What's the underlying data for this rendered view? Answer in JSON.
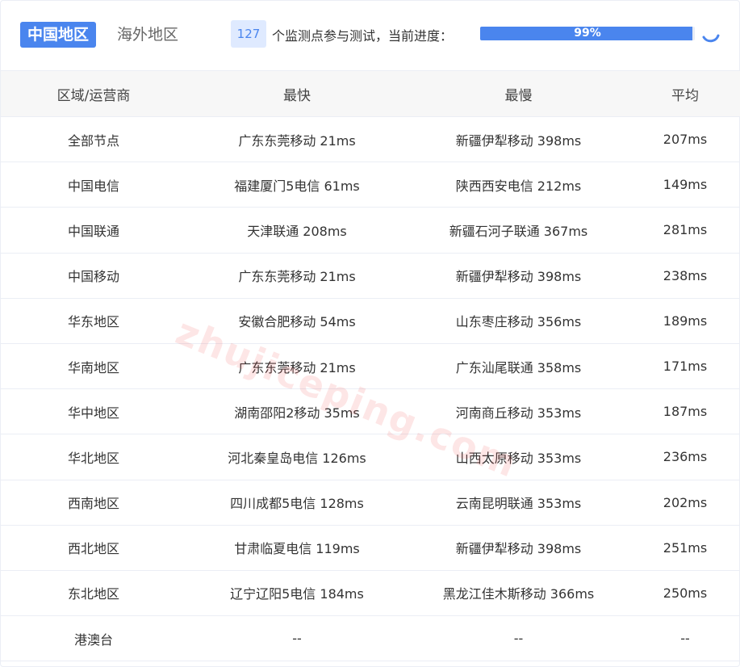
{
  "tabs": {
    "china": "中国地区",
    "overseas": "海外地区"
  },
  "monitor": {
    "count": "127",
    "text": "个监测点参与测试，当前进度：",
    "progress_label": "99%",
    "progress_fraction": 0.99
  },
  "watermark": "zhujiceping.com",
  "table": {
    "headers": [
      "区域/运营商",
      "最快",
      "最慢",
      "平均"
    ],
    "rows": [
      [
        "全部节点",
        "广东东莞移动 21ms",
        "新疆伊犁移动 398ms",
        "207ms"
      ],
      [
        "中国电信",
        "福建厦门5电信 61ms",
        "陕西西安电信 212ms",
        "149ms"
      ],
      [
        "中国联通",
        "天津联通 208ms",
        "新疆石河子联通 367ms",
        "281ms"
      ],
      [
        "中国移动",
        "广东东莞移动 21ms",
        "新疆伊犁移动 398ms",
        "238ms"
      ],
      [
        "华东地区",
        "安徽合肥移动 54ms",
        "山东枣庄移动 356ms",
        "189ms"
      ],
      [
        "华南地区",
        "广东东莞移动 21ms",
        "广东汕尾联通 358ms",
        "171ms"
      ],
      [
        "华中地区",
        "湖南邵阳2移动 35ms",
        "河南商丘移动 353ms",
        "187ms"
      ],
      [
        "华北地区",
        "河北秦皇岛电信 126ms",
        "山西太原移动 353ms",
        "236ms"
      ],
      [
        "西南地区",
        "四川成都5电信 128ms",
        "云南昆明联通 353ms",
        "202ms"
      ],
      [
        "西北地区",
        "甘肃临夏电信 119ms",
        "新疆伊犁移动 398ms",
        "251ms"
      ],
      [
        "东北地区",
        "辽宁辽阳5电信 184ms",
        "黑龙江佳木斯移动 366ms",
        "250ms"
      ],
      [
        "港澳台",
        "--",
        "--",
        "--"
      ]
    ]
  },
  "colors": {
    "accent": "#4a85ee",
    "header_bg": "#f7f7f7"
  }
}
